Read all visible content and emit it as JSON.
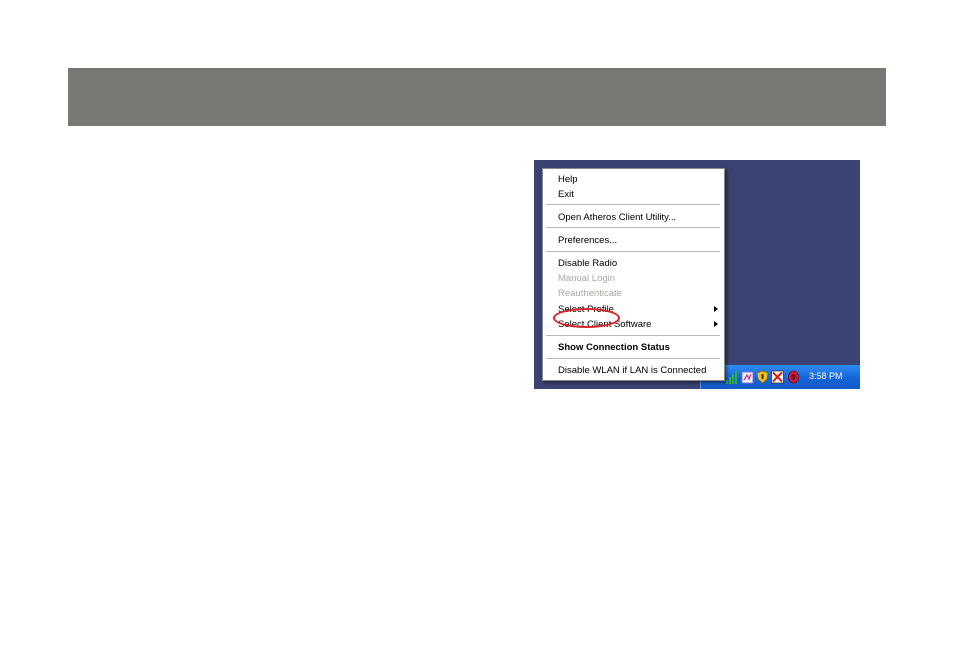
{
  "context_menu": {
    "items": [
      {
        "label": "Help",
        "enabled": true
      },
      {
        "label": "Exit",
        "enabled": true
      },
      {
        "label": "Open Atheros Client Utility...",
        "enabled": true
      },
      {
        "label": "Preferences...",
        "enabled": true
      },
      {
        "label": "Disable Radio",
        "enabled": true
      },
      {
        "label": "Manual Login",
        "enabled": false
      },
      {
        "label": "Reauthenticate",
        "enabled": false
      },
      {
        "label": "Select Profile",
        "enabled": true,
        "submenu": true,
        "highlighted": true
      },
      {
        "label": "Select Client Software",
        "enabled": true,
        "submenu": true
      },
      {
        "label": "Show Connection Status",
        "enabled": true,
        "bold": true
      },
      {
        "label": "Disable WLAN if LAN is Connected",
        "enabled": true
      }
    ]
  },
  "taskbar": {
    "clock": "3:58 PM",
    "tray_icons": [
      "signal-strength-icon",
      "note-icon",
      "shield-icon",
      "red-x-icon",
      "red-shield-icon"
    ]
  },
  "colors": {
    "header_bar": "#787875",
    "desktop": "#3a4372",
    "taskbar": "#1a73e0",
    "highlight_ring": "#d7262a",
    "disabled_text": "#a8a8a2"
  }
}
